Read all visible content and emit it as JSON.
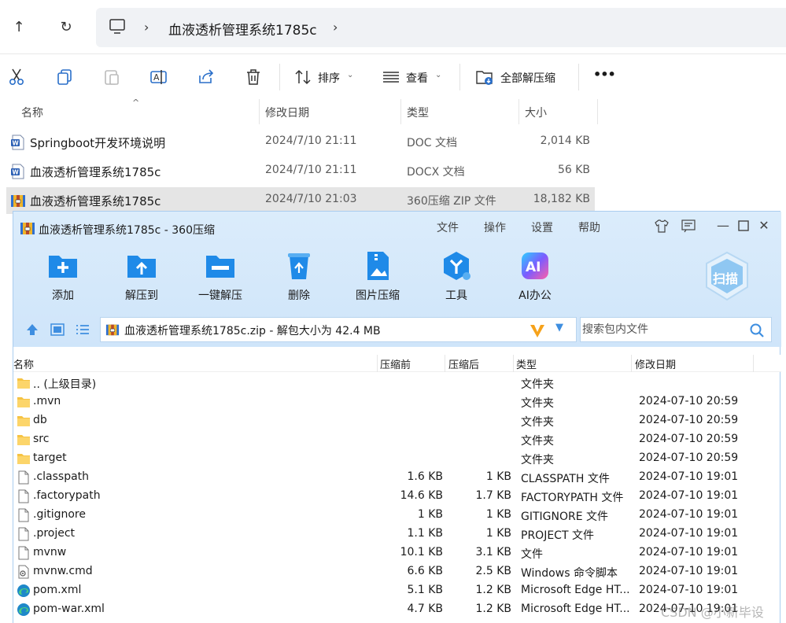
{
  "explorer": {
    "path_title": "血液透析管理系统1785c",
    "toolbar": {
      "sort_label": "排序",
      "view_label": "查看",
      "extract_all_label": "全部解压缩",
      "more_label": "•••"
    },
    "columns": {
      "name": "名称",
      "modified": "修改日期",
      "type": "类型",
      "size": "大小"
    },
    "files": [
      {
        "name": "Springboot开发环境说明",
        "modified": "2024/7/10 21:11",
        "type": "DOC 文档",
        "size": "2,014 KB",
        "icon": "word-doc-icon"
      },
      {
        "name": "血液透析管理系统1785c",
        "modified": "2024/7/10 21:11",
        "type": "DOCX 文档",
        "size": "56 KB",
        "icon": "word-doc-icon"
      },
      {
        "name": "血液透析管理系统1785c",
        "modified": "2024/7/10 21:03",
        "type": "360压缩 ZIP 文件",
        "size": "18,182 KB",
        "icon": "zip-archive-icon",
        "selected": true
      }
    ]
  },
  "zip": {
    "title": "血液透析管理系统1785c - 360压缩",
    "menu": [
      "文件",
      "操作",
      "设置",
      "帮助"
    ],
    "tools": [
      "添加",
      "解压到",
      "一键解压",
      "删除",
      "图片压缩",
      "工具",
      "AI办公"
    ],
    "scan_label": "扫描",
    "path_text": "血液透析管理系统1785c.zip - 解包大小为 42.4 MB",
    "search_placeholder": "搜索包内文件",
    "columns": {
      "name": "名称",
      "packed": "压缩前",
      "compressed": "压缩后",
      "type": "类型",
      "modified": "修改日期"
    },
    "rows": [
      {
        "name": ".. (上级目录)",
        "packed": "",
        "compressed": "",
        "type": "文件夹",
        "modified": "",
        "icon": "folder"
      },
      {
        "name": ".mvn",
        "packed": "",
        "compressed": "",
        "type": "文件夹",
        "modified": "2024-07-10 20:59",
        "icon": "folder"
      },
      {
        "name": "db",
        "packed": "",
        "compressed": "",
        "type": "文件夹",
        "modified": "2024-07-10 20:59",
        "icon": "folder"
      },
      {
        "name": "src",
        "packed": "",
        "compressed": "",
        "type": "文件夹",
        "modified": "2024-07-10 20:59",
        "icon": "folder"
      },
      {
        "name": "target",
        "packed": "",
        "compressed": "",
        "type": "文件夹",
        "modified": "2024-07-10 20:59",
        "icon": "folder"
      },
      {
        "name": ".classpath",
        "packed": "1.6 KB",
        "compressed": "1 KB",
        "type": "CLASSPATH 文件",
        "modified": "2024-07-10 19:01",
        "icon": "file"
      },
      {
        "name": ".factorypath",
        "packed": "14.6 KB",
        "compressed": "1.7 KB",
        "type": "FACTORYPATH 文件",
        "modified": "2024-07-10 19:01",
        "icon": "file"
      },
      {
        "name": ".gitignore",
        "packed": "1 KB",
        "compressed": "1 KB",
        "type": "GITIGNORE 文件",
        "modified": "2024-07-10 19:01",
        "icon": "file"
      },
      {
        "name": ".project",
        "packed": "1.1 KB",
        "compressed": "1 KB",
        "type": "PROJECT 文件",
        "modified": "2024-07-10 19:01",
        "icon": "file"
      },
      {
        "name": "mvnw",
        "packed": "10.1 KB",
        "compressed": "3.1 KB",
        "type": "文件",
        "modified": "2024-07-10 19:01",
        "icon": "file"
      },
      {
        "name": "mvnw.cmd",
        "packed": "6.6 KB",
        "compressed": "2.5 KB",
        "type": "Windows 命令脚本",
        "modified": "2024-07-10 19:01",
        "icon": "cmd"
      },
      {
        "name": "pom.xml",
        "packed": "5.1 KB",
        "compressed": "1.2 KB",
        "type": "Microsoft Edge HT...",
        "modified": "2024-07-10 19:01",
        "icon": "edge"
      },
      {
        "name": "pom-war.xml",
        "packed": "4.7 KB",
        "compressed": "1.2 KB",
        "type": "Microsoft Edge HT...",
        "modified": "2024-07-10 19:01",
        "icon": "edge"
      }
    ]
  },
  "watermark": "CSDN @小新毕设"
}
